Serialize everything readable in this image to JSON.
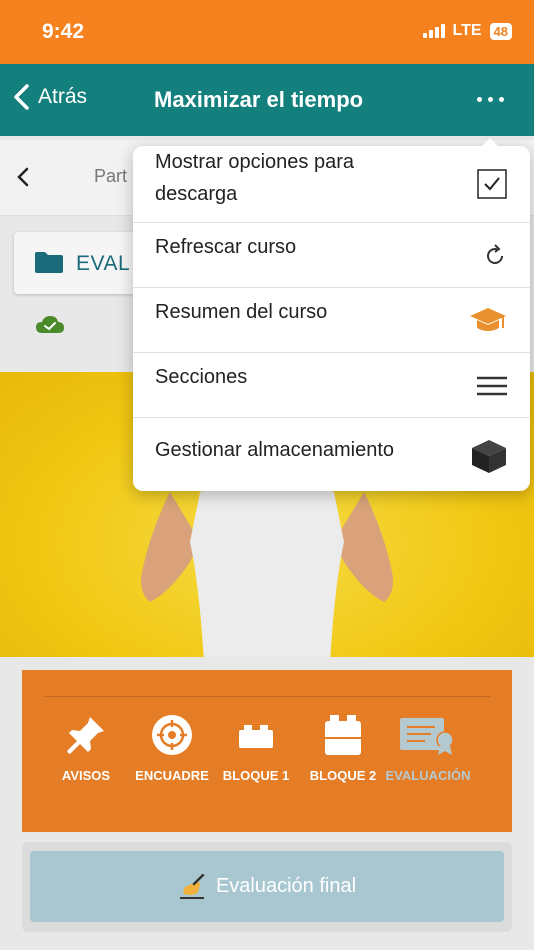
{
  "status_bar": {
    "time": "9:42",
    "network": "LTE",
    "battery": "48"
  },
  "nav": {
    "back_label": "Atrás",
    "title": "Maximizar el tiempo"
  },
  "sub_header": {
    "title": "Part"
  },
  "section": {
    "label": "EVAL"
  },
  "menu": {
    "items": [
      {
        "label": "Mostrar opciones para descarga",
        "icon": "checkbox-checked-icon"
      },
      {
        "label": "Refrescar curso",
        "icon": "refresh-icon"
      },
      {
        "label": "Resumen del curso",
        "icon": "graduation-cap-icon"
      },
      {
        "label": "Secciones",
        "icon": "hamburger-icon"
      },
      {
        "label": "Gestionar almacenamiento",
        "icon": "box-icon"
      }
    ]
  },
  "tools": [
    {
      "label": "AVISOS",
      "icon": "pushpin-icon"
    },
    {
      "label": "ENCUADRE",
      "icon": "target-icon"
    },
    {
      "label": "BLOQUE 1",
      "icon": "brick-small-icon"
    },
    {
      "label": "BLOQUE 2",
      "icon": "brick-large-icon"
    },
    {
      "label": "EVALUACIÓN",
      "icon": "certificate-icon"
    }
  ],
  "final_button": {
    "label": "Evaluación final",
    "icon": "writing-hand-icon"
  },
  "colors": {
    "status_bar": "#f5821f",
    "nav_bar": "#13807d",
    "panel": "#e57c26",
    "final_button": "#a9c7d0",
    "accent_icon": "#e8912e"
  }
}
